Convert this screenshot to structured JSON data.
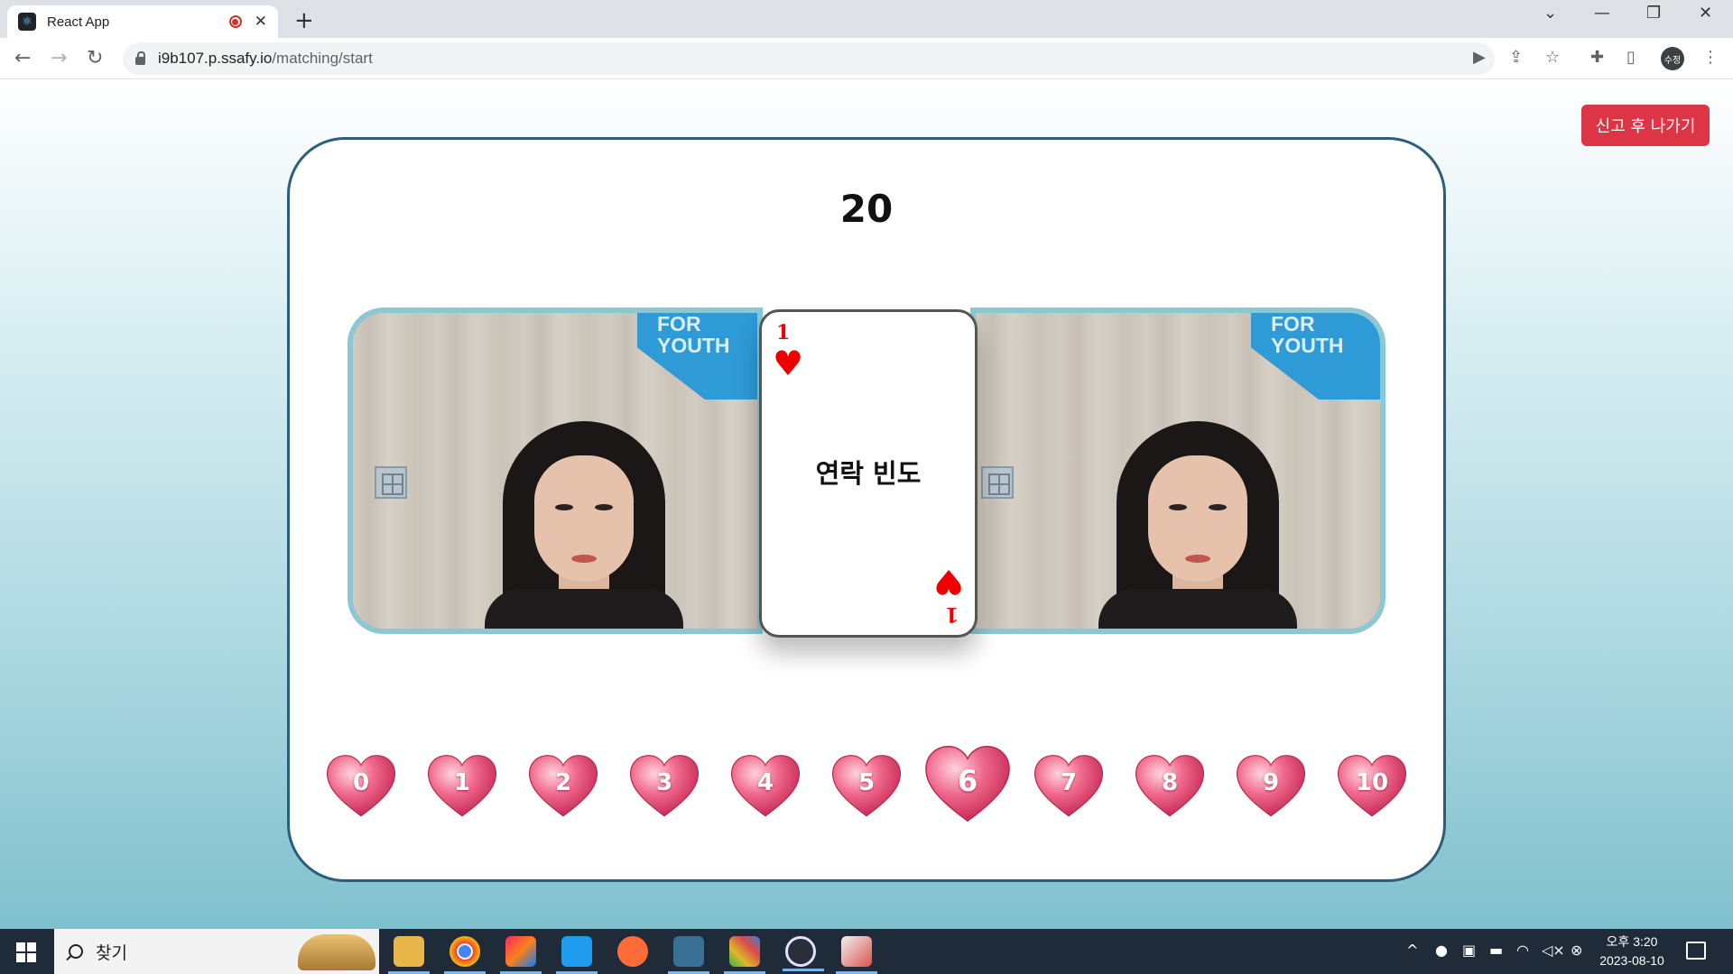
{
  "browser": {
    "tab_title": "React App",
    "url_host": "i9b107.p.ssafy.io",
    "url_path": "/matching/start",
    "profile_initials": "수정"
  },
  "page": {
    "report_button": "신고 후 나가기",
    "timer": "20",
    "video_banner": [
      "FOR",
      "YOUTH"
    ],
    "card": {
      "rank": "1",
      "suit": "heart",
      "topic": "연락 빈도",
      "color": "#e00000"
    },
    "score_hearts": [
      "0",
      "1",
      "2",
      "3",
      "4",
      "5",
      "6",
      "7",
      "8",
      "9",
      "10"
    ],
    "selected_score": "6"
  },
  "taskbar": {
    "search_placeholder": "찾기",
    "clock_time": "오후 3:20",
    "clock_date": "2023-08-10",
    "apps": [
      "file-explorer-icon",
      "chrome-icon",
      "intellij-icon",
      "vscode-icon",
      "postman-icon",
      "mysql-workbench-icon",
      "sourcetree-icon",
      "obs-icon",
      "mattermost-icon"
    ]
  }
}
